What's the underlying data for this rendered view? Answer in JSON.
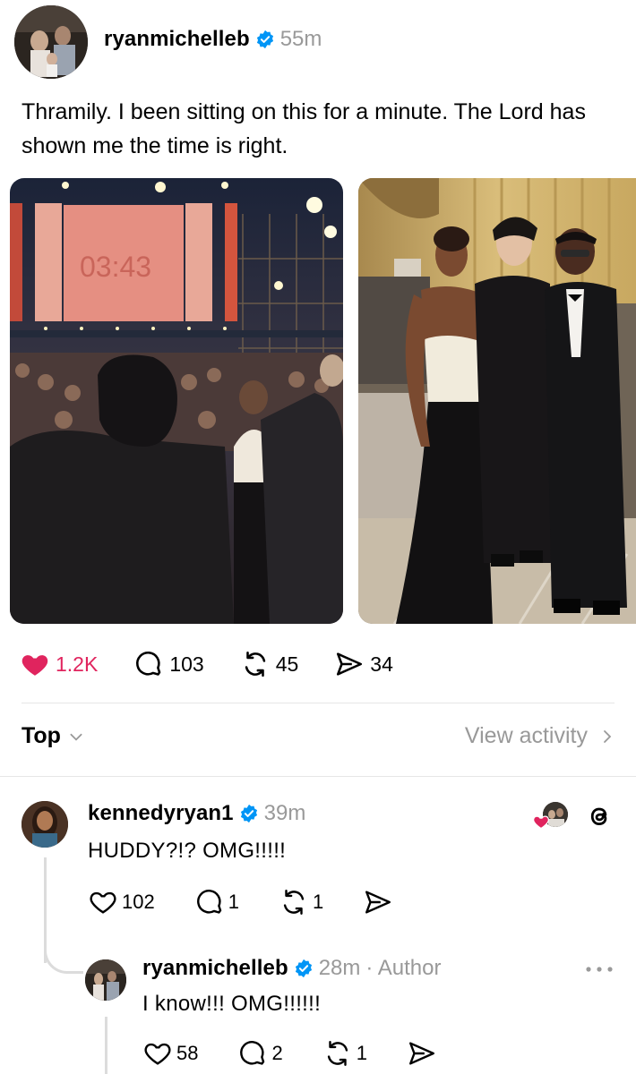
{
  "post": {
    "username": "ryanmichelleb",
    "time": "55m",
    "caption": "Thramily. I been sitting on this for a minute. The Lord has shown me the time is right.",
    "photo1_clock": "03:43",
    "actions": {
      "likes": "1.2K",
      "comments": "103",
      "reposts": "45",
      "shares": "34"
    }
  },
  "sort": {
    "label": "Top",
    "view_activity": "View activity"
  },
  "replies": [
    {
      "username": "kennedyryan1",
      "time": "39m",
      "text": "HUDDY?!? OMG!!!!!",
      "likes": "102",
      "comments": "1",
      "reposts": "1"
    },
    {
      "username": "ryanmichelleb",
      "time": "28m",
      "author_label": "· Author",
      "text": "I know!!! OMG!!!!!!",
      "likes": "58",
      "comments": "2",
      "reposts": "1"
    }
  ],
  "colors": {
    "like_red": "#e0245e",
    "verified_blue": "#0095f6",
    "muted_gray": "#999999"
  },
  "icons": [
    "heart-icon",
    "comment-icon",
    "repost-icon",
    "share-icon",
    "verified-icon",
    "chevron-down-icon",
    "chevron-right-icon",
    "threads-logo-icon",
    "more-icon"
  ]
}
